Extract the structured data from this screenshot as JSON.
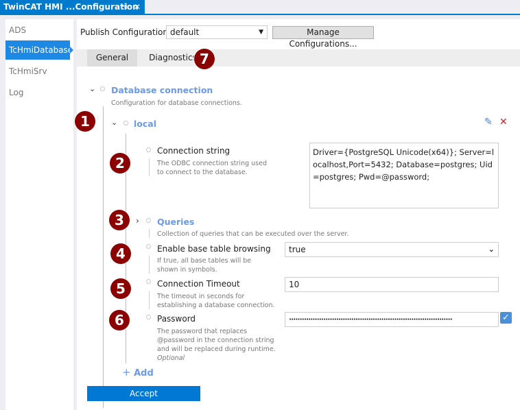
{
  "window": {
    "tab_title": "TwinCAT HMI ...Configuration",
    "pin_icon": "pin-icon",
    "close_icon": "close-icon"
  },
  "sidebar": {
    "items": [
      {
        "label": "ADS"
      },
      {
        "label": "TcHmiDatabase",
        "active": true
      },
      {
        "label": "TcHmiSrv"
      },
      {
        "label": "Log"
      }
    ]
  },
  "header": {
    "publish_label": "Publish Configuration:",
    "publish_value": "default",
    "manage_button": "Manage Configurations..."
  },
  "tabs": [
    {
      "label": "General",
      "active": true
    },
    {
      "label": "Diagnostics"
    }
  ],
  "tree": {
    "root": {
      "title": "Database connection",
      "description": "Configuration for database connections."
    },
    "local": {
      "title": "local",
      "edit_icon": "pencil-icon",
      "delete_icon": "x-icon"
    },
    "connection_string": {
      "label": "Connection string",
      "description": "The ODBC connection string used to connect to the database.",
      "value": "Driver={PostgreSQL Unicode(x64)}; Server=localhost,Port=5432; Database=postgres; Uid=postgres; Pwd=@password;"
    },
    "queries": {
      "title": "Queries",
      "description": "Collection of queries that can be executed over the server."
    },
    "base_table": {
      "label": "Enable base table browsing",
      "description": "If true, all base tables will be shown in symbols.",
      "value": "true"
    },
    "timeout": {
      "label": "Connection Timeout",
      "description": "The timeout in seconds for establishing a database connection.",
      "value": "10"
    },
    "password": {
      "label": "Password",
      "description": "The password that replaces @password in the connection string and will be replaced during runtime.",
      "optional": "Optional",
      "value": "••••••••••••••••••••••••••••••••••••••••••••••••••••••••••••••••••••••••••••",
      "checked": true
    },
    "add_label": "Add"
  },
  "accept_button": "Accept",
  "badges": [
    "1",
    "2",
    "3",
    "4",
    "5",
    "6",
    "7"
  ],
  "colors": {
    "accent": "#007acc",
    "link": "#6b9ae8",
    "badge": "#8b0000",
    "button": "#0078d4"
  }
}
